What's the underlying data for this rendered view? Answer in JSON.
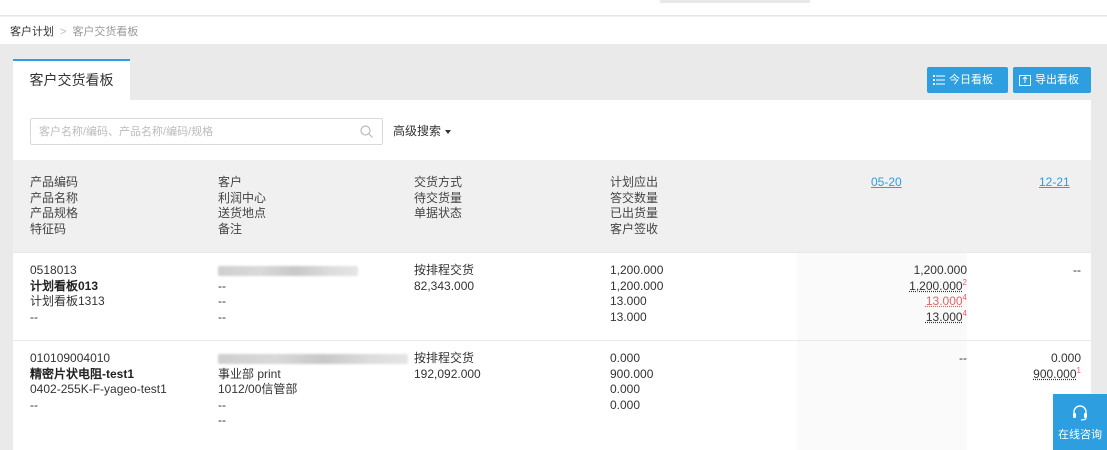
{
  "breadcrumb": {
    "root": "客户计划",
    "separator": ">",
    "current": "客户交货看板"
  },
  "tab": {
    "label": "客户交货看板"
  },
  "toolbar": {
    "today_label": "今日看板",
    "export_label": "导出看板"
  },
  "search": {
    "placeholder": "客户名称/编码、产品名称/编码/规格",
    "value": "",
    "advanced_label": "高级搜索"
  },
  "header": {
    "col1": [
      "产品编码",
      "产品名称",
      "产品规格",
      "特征码"
    ],
    "col2": [
      "客户",
      "利润中心",
      "送货地点",
      "备注"
    ],
    "col3": [
      "交货方式",
      "待交货量",
      "单据状态"
    ],
    "col4": [
      "计划应出",
      "答交数量",
      "已出货量",
      "客户签收"
    ],
    "dates": [
      "05-20",
      "12-21"
    ]
  },
  "rows": [
    {
      "code": "0518013",
      "name": "计划看板013",
      "spec": "计划看板1313",
      "feature": "--",
      "customer": "",
      "profit_center": "--",
      "location": "--",
      "remark": "--",
      "delivery_mode": "按排程交货",
      "pending_qty": "82,343.000",
      "planned": "1,200.000",
      "answered": "1,200.000",
      "shipped": "13.000",
      "signed": "13.000",
      "d1": {
        "v1": "1,200.000",
        "v2": "1,200.000",
        "v2_badge": "2",
        "v3": "13.000",
        "v3_badge": "4",
        "v4": "13.000",
        "v4_badge": "4"
      },
      "d2": {
        "v1": "--"
      }
    },
    {
      "code": "010109004010",
      "name": "精密片状电阻-test1",
      "spec": "0402-255K-F-yageo-test1",
      "feature": "--",
      "customer": "",
      "profit_center": "事业部 print",
      "location": "1012/00信管部",
      "remark": "--",
      "remark2": "--",
      "delivery_mode": "按排程交货",
      "pending_qty": "192,092.000",
      "planned": "0.000",
      "answered": "900.000",
      "shipped": "0.000",
      "signed": "0.000",
      "d1": {
        "v1": "--"
      },
      "d2": {
        "v1": "0.000",
        "v2": "900.000",
        "v2_badge": "1"
      }
    }
  ],
  "chat": {
    "label": "在线咨询"
  },
  "colors": {
    "accent": "#2d9ee0",
    "warn": "#e06666"
  }
}
